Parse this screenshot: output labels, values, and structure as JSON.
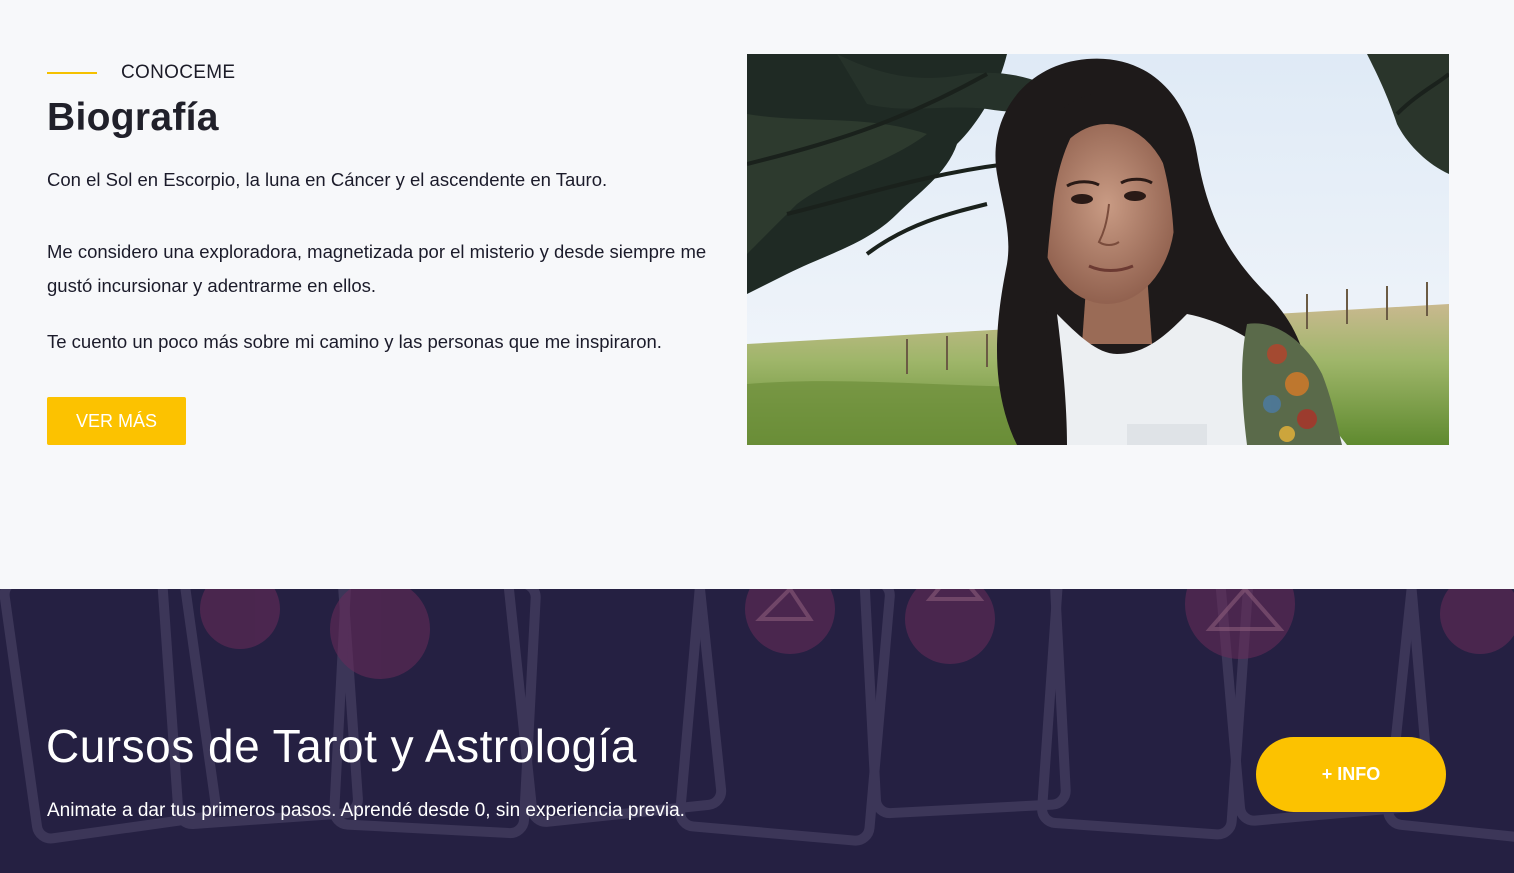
{
  "bio": {
    "eyebrow": "CONOCEME",
    "title": "Biografía",
    "paragraph_1": "Con el Sol en Escorpio, la luna en Cáncer y el ascendente en Tauro.",
    "paragraph_2": "Me considero una exploradora, magnetizada por el misterio y desde siempre me gustó incursionar  y  adentrarme en ellos.",
    "paragraph_3": "Te cuento un poco más sobre mi camino y las personas que me inspiraron.",
    "button_label": "VER MÁS"
  },
  "courses": {
    "title": "Cursos de Tarot y Astrología",
    "subtitle": "Animate a dar tus primeros pasos. Aprendé desde 0, sin experiencia previa.",
    "button_label": "+ INFO"
  },
  "colors": {
    "accent": "#fcc200",
    "dark_section": "#252042",
    "light_section": "#f7f8fa",
    "text": "#1b1b2a"
  }
}
